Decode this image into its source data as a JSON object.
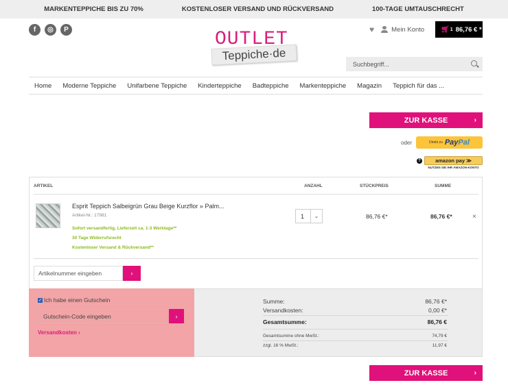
{
  "topbar": [
    "MARKENTEPPICHE BIS ZU 70%",
    "KOSTENLOSER VERSAND UND RÜCKVERSAND",
    "100-TAGE UMTAUSCHRECHT"
  ],
  "social": [
    "f",
    "◎",
    "P"
  ],
  "logo": {
    "line1": "OUTLET",
    "line2": "Teppiche·de"
  },
  "account": {
    "label": "Mein Konto"
  },
  "cart": {
    "count": "1",
    "total": "86,76 € *"
  },
  "search": {
    "placeholder": "Suchbegriff..."
  },
  "nav": [
    "Home",
    "Moderne Teppiche",
    "Unifarbene Teppiche",
    "Kinderteppiche",
    "Badteppiche",
    "Markenteppiche",
    "Magazin",
    "Teppich für das ..."
  ],
  "checkout_label": "ZUR KASSE",
  "payment": {
    "oder": "oder",
    "paypal_small": "Direkt zu",
    "paypal_pay": "Pay",
    "paypal_pal": "Pal",
    "amazon": "amazon pay  ≫",
    "amazon_sub": "NUTZEN SIE IHR AMAZON-KONTO"
  },
  "table": {
    "headers": {
      "article": "ARTIKEL",
      "qty": "ANZAHL",
      "unit": "STÜCKPREIS",
      "sum": "SUMME"
    },
    "item": {
      "name": "Esprit Teppich Salbeigrün Grau Beige Kurzflor » Palm...",
      "number": "Artikel-Nr.: 17981",
      "notes": [
        "Sofort versandfertig, Lieferzeit ca. 1-3 Werktage**",
        "30 Tage Widerrufsrecht",
        "Kostenloser Versand & Rückversand**"
      ],
      "qty": "1",
      "unit_price": "86,76 €*",
      "sum": "86,76 €*",
      "remove": "×"
    },
    "article_input_placeholder": "Artikelnummer eingeben"
  },
  "coupon": {
    "checkbox_label": "Ich habe einen Gutschein",
    "input_placeholder": "Gutschein-Code eingeben",
    "shipping_link": "Versandkosten ›"
  },
  "totals": [
    {
      "label": "Summe:",
      "value": "86,76 €*"
    },
    {
      "label": "Versandkosten:",
      "value": "0,00 €*"
    },
    {
      "label": "Gesamtsumme:",
      "value": "86,76 €"
    },
    {
      "label": "Gesamtsumme ohne MwSt.:",
      "value": "74,79 €"
    },
    {
      "label": "zzgl. 16 % MwSt.:",
      "value": "11,97 €"
    }
  ],
  "colors": {
    "accent": "#e0117a",
    "coupon_bg": "#f2a4a6",
    "green": "#8cba1e"
  }
}
